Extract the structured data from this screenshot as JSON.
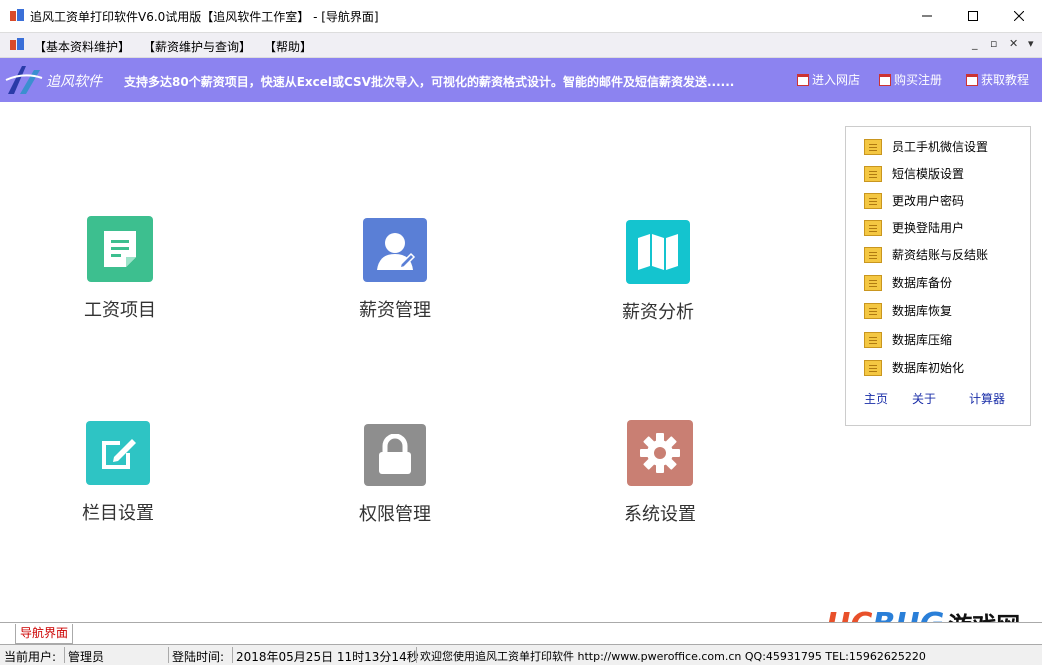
{
  "window": {
    "title": "追风工资单打印软件V6.0试用版【追风软件工作室】 - [导航界面]",
    "controls": [
      "minimize",
      "maximize",
      "close"
    ]
  },
  "menu": {
    "items": [
      "【基本资料维护】",
      "【薪资维护与查询】",
      "【帮助】"
    ],
    "mdi_controls": [
      "_",
      "▫",
      "✕",
      "▾"
    ]
  },
  "banner": {
    "brand": "追风软件",
    "slogan": "支持多达80个薪资项目，快速从Excel或CSV批次导入，可视化的薪资格式设计。智能的邮件及短信薪资发送......",
    "links": [
      "进入网店",
      "购买注册",
      "获取教程"
    ]
  },
  "tiles": [
    {
      "label": "工资项目",
      "icon": "document-icon",
      "color": "#3dbf8f"
    },
    {
      "label": "薪资管理",
      "icon": "user-edit-icon",
      "color": "#5a7fd6"
    },
    {
      "label": "薪资分析",
      "icon": "map-icon",
      "color": "#14c4cf"
    },
    {
      "label": "栏目设置",
      "icon": "edit-icon",
      "color": "#2ec4c4"
    },
    {
      "label": "权限管理",
      "icon": "lock-icon",
      "color": "#8e8e8e"
    },
    {
      "label": "系统设置",
      "icon": "gear-icon",
      "color": "#c97f73"
    }
  ],
  "side": {
    "items": [
      "员工手机微信设置",
      "短信模版设置",
      "更改用户密码",
      "更换登陆用户",
      "薪资结账与反结账",
      "数据库备份",
      "数据库恢复",
      "数据库压缩",
      "数据库初始化"
    ],
    "links": [
      "主页",
      "关于",
      "计算器"
    ]
  },
  "tab": {
    "label": "导航界面"
  },
  "status": {
    "user_label": "当前用户:",
    "user": "管理员",
    "time_label": "登陆时间:",
    "time": "2018年05月25日 11时13分14秒",
    "welcome": "欢迎您使用追风工资单打印软件 http://www.pweroffice.com.cn QQ:45931795 TEL:15962625220"
  },
  "watermark": {
    "text": "UCBUG游戏网"
  }
}
